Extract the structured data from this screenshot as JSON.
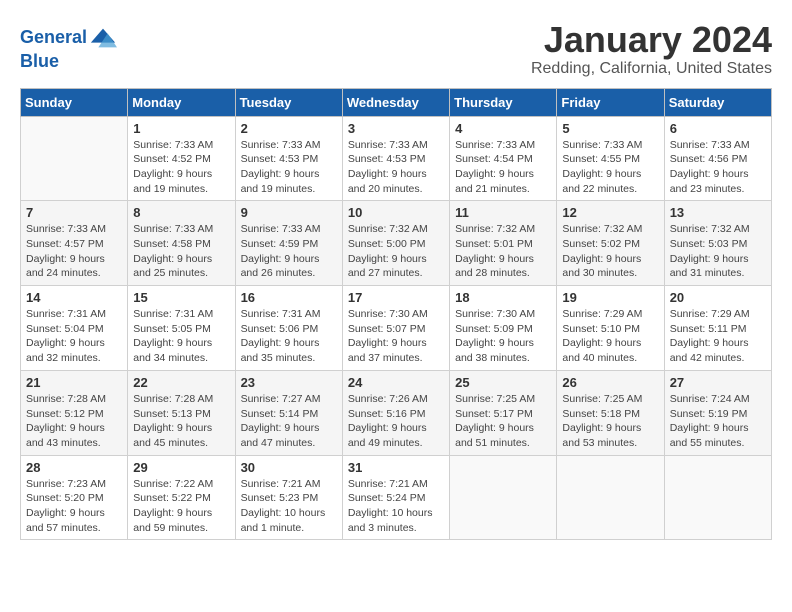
{
  "header": {
    "logo_line1": "General",
    "logo_line2": "Blue",
    "title": "January 2024",
    "subtitle": "Redding, California, United States"
  },
  "weekdays": [
    "Sunday",
    "Monday",
    "Tuesday",
    "Wednesday",
    "Thursday",
    "Friday",
    "Saturday"
  ],
  "weeks": [
    [
      {
        "day": null
      },
      {
        "day": "1",
        "sunrise": "7:33 AM",
        "sunset": "4:52 PM",
        "daylight": "9 hours and 19 minutes."
      },
      {
        "day": "2",
        "sunrise": "7:33 AM",
        "sunset": "4:53 PM",
        "daylight": "9 hours and 19 minutes."
      },
      {
        "day": "3",
        "sunrise": "7:33 AM",
        "sunset": "4:53 PM",
        "daylight": "9 hours and 20 minutes."
      },
      {
        "day": "4",
        "sunrise": "7:33 AM",
        "sunset": "4:54 PM",
        "daylight": "9 hours and 21 minutes."
      },
      {
        "day": "5",
        "sunrise": "7:33 AM",
        "sunset": "4:55 PM",
        "daylight": "9 hours and 22 minutes."
      },
      {
        "day": "6",
        "sunrise": "7:33 AM",
        "sunset": "4:56 PM",
        "daylight": "9 hours and 23 minutes."
      }
    ],
    [
      {
        "day": "7",
        "sunrise": "7:33 AM",
        "sunset": "4:57 PM",
        "daylight": "9 hours and 24 minutes."
      },
      {
        "day": "8",
        "sunrise": "7:33 AM",
        "sunset": "4:58 PM",
        "daylight": "9 hours and 25 minutes."
      },
      {
        "day": "9",
        "sunrise": "7:33 AM",
        "sunset": "4:59 PM",
        "daylight": "9 hours and 26 minutes."
      },
      {
        "day": "10",
        "sunrise": "7:32 AM",
        "sunset": "5:00 PM",
        "daylight": "9 hours and 27 minutes."
      },
      {
        "day": "11",
        "sunrise": "7:32 AM",
        "sunset": "5:01 PM",
        "daylight": "9 hours and 28 minutes."
      },
      {
        "day": "12",
        "sunrise": "7:32 AM",
        "sunset": "5:02 PM",
        "daylight": "9 hours and 30 minutes."
      },
      {
        "day": "13",
        "sunrise": "7:32 AM",
        "sunset": "5:03 PM",
        "daylight": "9 hours and 31 minutes."
      }
    ],
    [
      {
        "day": "14",
        "sunrise": "7:31 AM",
        "sunset": "5:04 PM",
        "daylight": "9 hours and 32 minutes."
      },
      {
        "day": "15",
        "sunrise": "7:31 AM",
        "sunset": "5:05 PM",
        "daylight": "9 hours and 34 minutes."
      },
      {
        "day": "16",
        "sunrise": "7:31 AM",
        "sunset": "5:06 PM",
        "daylight": "9 hours and 35 minutes."
      },
      {
        "day": "17",
        "sunrise": "7:30 AM",
        "sunset": "5:07 PM",
        "daylight": "9 hours and 37 minutes."
      },
      {
        "day": "18",
        "sunrise": "7:30 AM",
        "sunset": "5:09 PM",
        "daylight": "9 hours and 38 minutes."
      },
      {
        "day": "19",
        "sunrise": "7:29 AM",
        "sunset": "5:10 PM",
        "daylight": "9 hours and 40 minutes."
      },
      {
        "day": "20",
        "sunrise": "7:29 AM",
        "sunset": "5:11 PM",
        "daylight": "9 hours and 42 minutes."
      }
    ],
    [
      {
        "day": "21",
        "sunrise": "7:28 AM",
        "sunset": "5:12 PM",
        "daylight": "9 hours and 43 minutes."
      },
      {
        "day": "22",
        "sunrise": "7:28 AM",
        "sunset": "5:13 PM",
        "daylight": "9 hours and 45 minutes."
      },
      {
        "day": "23",
        "sunrise": "7:27 AM",
        "sunset": "5:14 PM",
        "daylight": "9 hours and 47 minutes."
      },
      {
        "day": "24",
        "sunrise": "7:26 AM",
        "sunset": "5:16 PM",
        "daylight": "9 hours and 49 minutes."
      },
      {
        "day": "25",
        "sunrise": "7:25 AM",
        "sunset": "5:17 PM",
        "daylight": "9 hours and 51 minutes."
      },
      {
        "day": "26",
        "sunrise": "7:25 AM",
        "sunset": "5:18 PM",
        "daylight": "9 hours and 53 minutes."
      },
      {
        "day": "27",
        "sunrise": "7:24 AM",
        "sunset": "5:19 PM",
        "daylight": "9 hours and 55 minutes."
      }
    ],
    [
      {
        "day": "28",
        "sunrise": "7:23 AM",
        "sunset": "5:20 PM",
        "daylight": "9 hours and 57 minutes."
      },
      {
        "day": "29",
        "sunrise": "7:22 AM",
        "sunset": "5:22 PM",
        "daylight": "9 hours and 59 minutes."
      },
      {
        "day": "30",
        "sunrise": "7:21 AM",
        "sunset": "5:23 PM",
        "daylight": "10 hours and 1 minute."
      },
      {
        "day": "31",
        "sunrise": "7:21 AM",
        "sunset": "5:24 PM",
        "daylight": "10 hours and 3 minutes."
      },
      {
        "day": null
      },
      {
        "day": null
      },
      {
        "day": null
      }
    ]
  ]
}
